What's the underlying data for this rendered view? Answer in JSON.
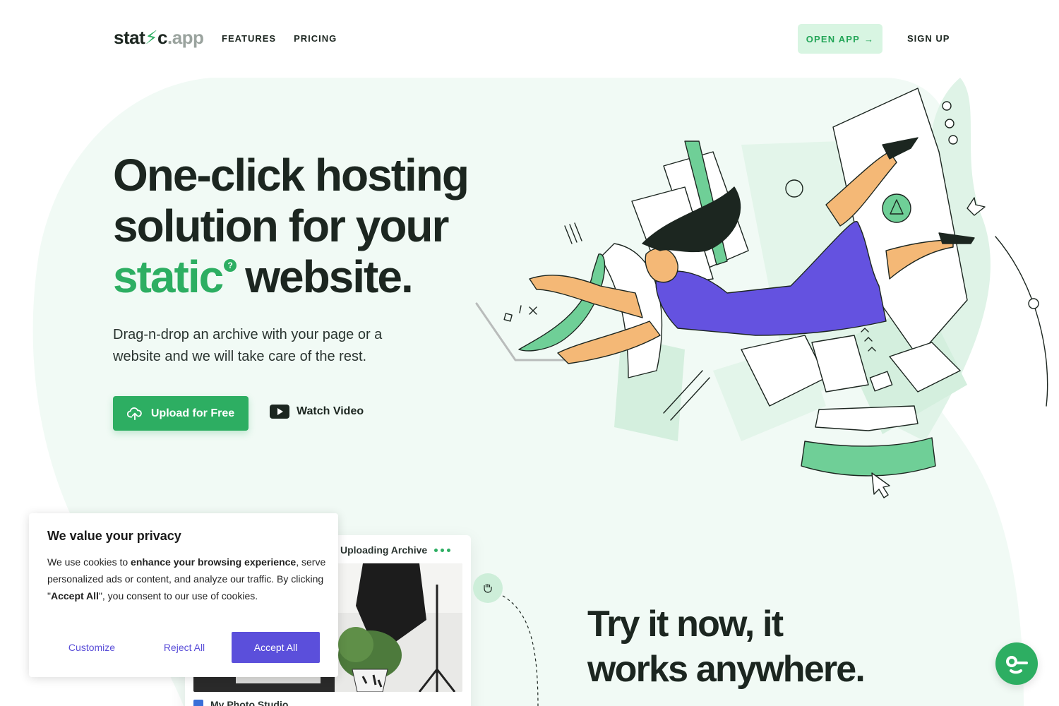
{
  "brand": {
    "logo_prefix": "stat",
    "logo_bolt": "⚡",
    "logo_mid": "c",
    "logo_tld": ".app"
  },
  "nav": {
    "features": "FEATURES",
    "pricing": "PRICING"
  },
  "header": {
    "open_app": "OPEN APP",
    "open_app_arrow": "→",
    "sign_up": "SIGN UP"
  },
  "hero": {
    "title_line1": "One-click hosting",
    "title_line2": "solution for your",
    "title_accent": "static",
    "title_qmark": "?",
    "title_end": "website.",
    "subtitle": "Drag-n-drop an archive with your page or a website and we will take care of the rest.",
    "upload_button": "Upload for Free",
    "watch_video": "Watch Video"
  },
  "upload_card": {
    "heading": "Uploading Archive",
    "item_label": "My Photo Studio"
  },
  "section2": {
    "title_line1": "Try it now, it",
    "title_line2": "works anywhere."
  },
  "cookie": {
    "title": "We value your privacy",
    "text_1": "We use cookies to ",
    "text_bold_1": "enhance your browsing experience",
    "text_2": ", serve personalized ads or content, and analyze our traffic. By clicking \"",
    "text_bold_2": "Accept All",
    "text_3": "\", you consent to our use of cookies.",
    "customize": "Customize",
    "reject": "Reject All",
    "accept": "Accept All"
  },
  "colors": {
    "accent_green": "#2dae62",
    "light_green": "#d8f5e2",
    "purple": "#5b4fdb",
    "dark_text": "#1c2620",
    "bg_tint": "#f1faf5"
  },
  "icons": [
    "upload-cloud-icon",
    "play-video-icon",
    "arrow-right-icon",
    "hand-grab-icon",
    "chat-widget-icon"
  ]
}
